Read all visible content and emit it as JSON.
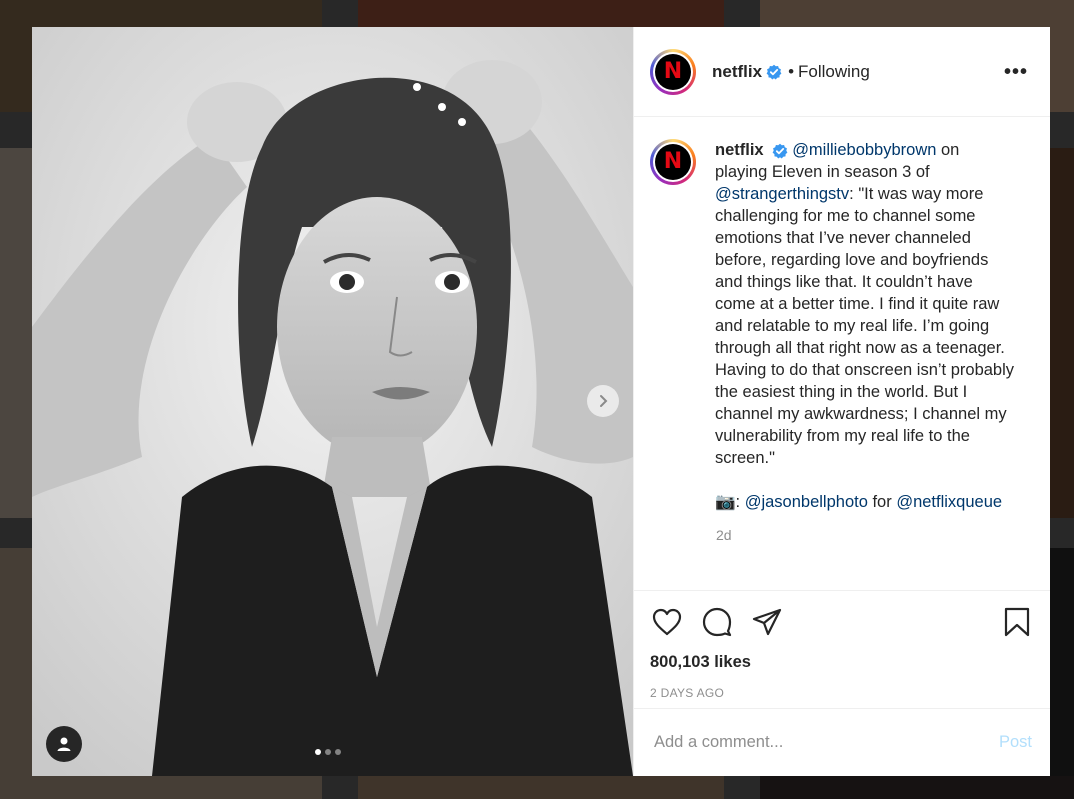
{
  "post": {
    "username": "netflix",
    "separator": "•",
    "following_label": "Following",
    "more_label": "•••",
    "logo_letter": "N"
  },
  "caption": {
    "username": "netflix",
    "mention_1": "@milliebobbybrown",
    "text_1": " on playing Eleven in season 3 of ",
    "mention_2": "@strangerthingstv",
    "text_2": ": \"It was way more challenging for me to channel some emotions that I’ve never channeled before, regarding love and boyfriends and things like that. It couldn’t have come at a better time. I find it quite raw and relatable to my real life. I’m going through all that right now as a teenager. Having to do that onscreen isn’t probably the easiest thing in the world. But I channel my awkwardness; I channel my vulnerability from my real life to the screen.\"",
    "camera_emoji": "📷",
    "text_3": ": ",
    "mention_3": "@jasonbellphoto",
    "text_4": " for ",
    "mention_4": "@netflixqueue",
    "time_ago": "2d"
  },
  "actions": {
    "likes": "800,103 likes",
    "date": "2 DAYS AGO"
  },
  "comment": {
    "placeholder": "Add a comment...",
    "post_label": "Post"
  },
  "carousel": {
    "total": 3,
    "active": 1
  },
  "colors": {
    "netflix_red": "#e50914",
    "verified_blue": "#3897f0",
    "mention": "#00376b",
    "post_disabled": "#b2dffc"
  }
}
